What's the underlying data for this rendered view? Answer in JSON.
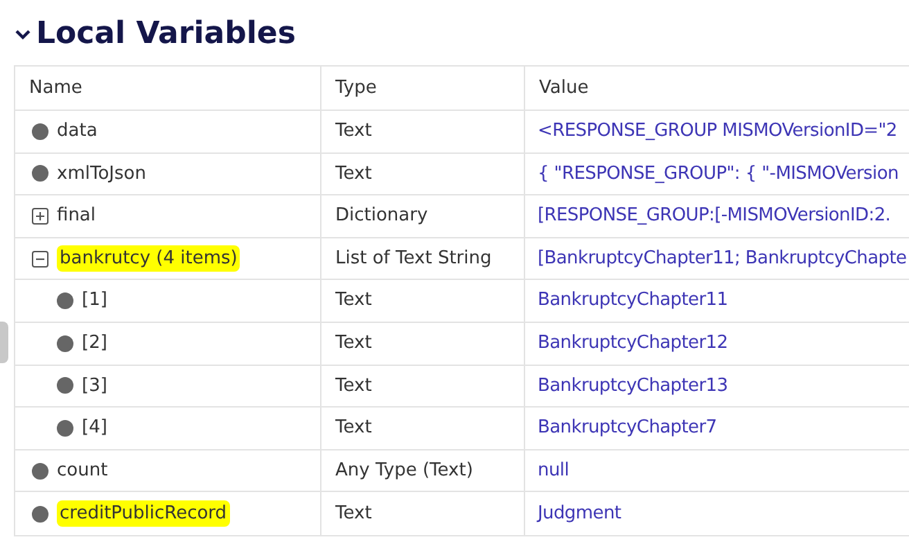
{
  "section": {
    "title": "Local Variables",
    "expanded": true
  },
  "table": {
    "columns": [
      "Name",
      "Type",
      "Value"
    ],
    "rows": [
      {
        "kind": "leaf",
        "name": "data",
        "type": "Text",
        "value": "<RESPONSE_GROUP MISMOVersionID=\"2",
        "highlighted": false
      },
      {
        "kind": "leaf",
        "name": "xmlToJson",
        "type": "Text",
        "value": "{ \"RESPONSE_GROUP\": { \"-MISMOVersion",
        "highlighted": false
      },
      {
        "kind": "group",
        "expanded": false,
        "name": "final",
        "type": "Dictionary",
        "value": "[RESPONSE_GROUP:[-MISMOVersionID:2.",
        "highlighted": false
      },
      {
        "kind": "group",
        "expanded": true,
        "name": "bankrutcy (4 items)",
        "type": "List of Text String",
        "value": "[BankruptcyChapter11; BankruptcyChapte",
        "highlighted": true,
        "children": [
          {
            "kind": "leaf",
            "name": "[1]",
            "type": "Text",
            "value": "BankruptcyChapter11",
            "highlighted": false
          },
          {
            "kind": "leaf",
            "name": "[2]",
            "type": "Text",
            "value": "BankruptcyChapter12",
            "highlighted": false
          },
          {
            "kind": "leaf",
            "name": "[3]",
            "type": "Text",
            "value": "BankruptcyChapter13",
            "highlighted": false
          },
          {
            "kind": "leaf",
            "name": "[4]",
            "type": "Text",
            "value": "BankruptcyChapter7",
            "highlighted": false
          }
        ]
      },
      {
        "kind": "leaf",
        "name": "count",
        "type": "Any Type (Text)",
        "value": "null",
        "highlighted": false
      },
      {
        "kind": "leaf",
        "name": "creditPublicRecord",
        "type": "Text",
        "value": "Judgment",
        "highlighted": true
      }
    ]
  }
}
